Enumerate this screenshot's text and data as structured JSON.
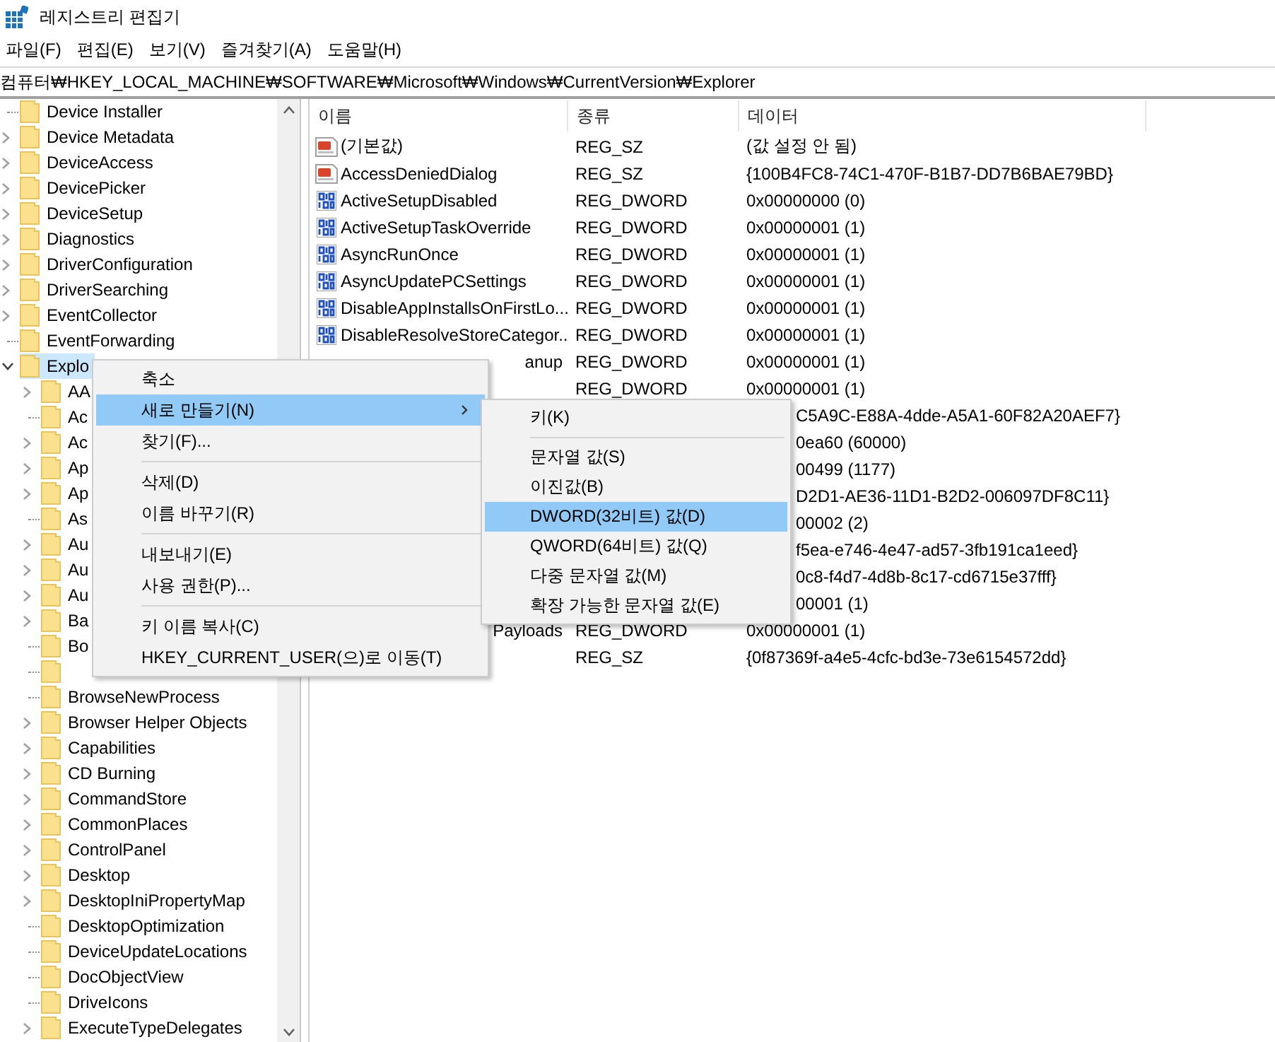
{
  "window": {
    "title": "레지스트리 편집기"
  },
  "menu_bar": [
    "파일(F)",
    "편집(E)",
    "보기(V)",
    "즐겨찾기(A)",
    "도움말(H)"
  ],
  "address_bar": {
    "value": "컴퓨터₩HKEY_LOCAL_MACHINE₩SOFTWARE₩Microsoft₩Windows₩CurrentVersion₩Explorer"
  },
  "tree": {
    "items": [
      {
        "label": "Device Installer",
        "has_children": false,
        "selected": false
      },
      {
        "label": "Device Metadata",
        "has_children": true,
        "expanded": false,
        "selected": false
      },
      {
        "label": "DeviceAccess",
        "has_children": true,
        "expanded": false,
        "selected": false
      },
      {
        "label": "DevicePicker",
        "has_children": true,
        "expanded": false,
        "selected": false
      },
      {
        "label": "DeviceSetup",
        "has_children": true,
        "expanded": false,
        "selected": false
      },
      {
        "label": "Diagnostics",
        "has_children": true,
        "expanded": false,
        "selected": false
      },
      {
        "label": "DriverConfiguration",
        "has_children": true,
        "expanded": false,
        "selected": false
      },
      {
        "label": "DriverSearching",
        "has_children": true,
        "expanded": false,
        "selected": false
      },
      {
        "label": "EventCollector",
        "has_children": true,
        "expanded": false,
        "selected": false
      },
      {
        "label": "EventForwarding",
        "has_children": false,
        "selected": false
      },
      {
        "label": "Explo",
        "has_children": true,
        "expanded": true,
        "selected": true,
        "children": [
          {
            "label": "AA",
            "has_children": true,
            "expanded": false,
            "selected": false
          },
          {
            "label": "Ac",
            "has_children": false,
            "selected": false
          },
          {
            "label": "Ac",
            "has_children": true,
            "expanded": false,
            "selected": false
          },
          {
            "label": "Ap",
            "has_children": true,
            "expanded": false,
            "selected": false
          },
          {
            "label": "Ap",
            "has_children": true,
            "expanded": false,
            "selected": false
          },
          {
            "label": "As",
            "has_children": false,
            "selected": false
          },
          {
            "label": "Au",
            "has_children": true,
            "expanded": false,
            "selected": false
          },
          {
            "label": "Au",
            "has_children": true,
            "expanded": false,
            "selected": false
          },
          {
            "label": "Au",
            "has_children": true,
            "expanded": false,
            "selected": false
          },
          {
            "label": "Ba",
            "has_children": true,
            "expanded": false,
            "selected": false
          },
          {
            "label": "Bo",
            "has_children": false,
            "selected": false
          },
          {
            "has_children": false,
            "selected": false
          },
          {
            "label": "BrowseNewProcess",
            "has_children": false,
            "selected": false
          },
          {
            "label": "Browser Helper Objects",
            "has_children": true,
            "expanded": false,
            "selected": false
          },
          {
            "label": "Capabilities",
            "has_children": true,
            "expanded": false,
            "selected": false
          },
          {
            "label": "CD Burning",
            "has_children": true,
            "expanded": false,
            "selected": false
          },
          {
            "label": "CommandStore",
            "has_children": true,
            "expanded": false,
            "selected": false
          },
          {
            "label": "CommonPlaces",
            "has_children": true,
            "expanded": false,
            "selected": false
          },
          {
            "label": "ControlPanel",
            "has_children": true,
            "expanded": false,
            "selected": false
          },
          {
            "label": "Desktop",
            "has_children": true,
            "expanded": false,
            "selected": false
          },
          {
            "label": "DesktopIniPropertyMap",
            "has_children": true,
            "expanded": false,
            "selected": false
          },
          {
            "label": "DesktopOptimization",
            "has_children": false,
            "selected": false
          },
          {
            "label": "DeviceUpdateLocations",
            "has_children": false,
            "selected": false
          },
          {
            "label": "DocObjectView",
            "has_children": false,
            "selected": false
          },
          {
            "label": "DriveIcons",
            "has_children": false,
            "selected": false
          },
          {
            "label": "ExecuteTypeDelegates",
            "has_children": true,
            "expanded": false,
            "selected": false
          }
        ]
      }
    ]
  },
  "list": {
    "columns": [
      "이름",
      "종류",
      "데이터"
    ],
    "rows": [
      {
        "kind": "string",
        "name": "(기본값)",
        "type": "REG_SZ",
        "data": "(값 설정 안 됨)"
      },
      {
        "kind": "string",
        "name": "AccessDeniedDialog",
        "type": "REG_SZ",
        "data": "{100B4FC8-74C1-470F-B1B7-DD7B6BAE79BD}"
      },
      {
        "kind": "binary",
        "name": "ActiveSetupDisabled",
        "type": "REG_DWORD",
        "data": "0x00000000 (0)"
      },
      {
        "kind": "binary",
        "name": "ActiveSetupTaskOverride",
        "type": "REG_DWORD",
        "data": "0x00000001 (1)"
      },
      {
        "kind": "binary",
        "name": "AsyncRunOnce",
        "type": "REG_DWORD",
        "data": "0x00000001 (1)"
      },
      {
        "kind": "binary",
        "name": "AsyncUpdatePCSettings",
        "type": "REG_DWORD",
        "data": "0x00000001 (1)"
      },
      {
        "kind": "binary",
        "name": "DisableAppInstallsOnFirstLo...",
        "type": "REG_DWORD",
        "data": "0x00000001 (1)"
      },
      {
        "kind": "binary",
        "name": "DisableResolveStoreCategor...",
        "type": "REG_DWORD",
        "data": "0x00000001 (1)"
      },
      {
        "kind": "name_tail",
        "name": "anup",
        "type": "REG_DWORD",
        "data": "0x00000001 (1)"
      },
      {
        "kind": "covered",
        "type": "REG_DWORD",
        "data": "0x00000001 (1)"
      },
      {
        "kind": "data_tail",
        "data": "C5A9C-E88A-4dde-A5A1-60F82A20AEF7}"
      },
      {
        "kind": "data_tail",
        "data": "0ea60 (60000)"
      },
      {
        "kind": "data_tail",
        "data": "00499 (1177)"
      },
      {
        "kind": "data_tail",
        "data": "D2D1-AE36-11D1-B2D2-006097DF8C11}"
      },
      {
        "kind": "data_tail",
        "data": "00002 (2)"
      },
      {
        "kind": "data_tail",
        "data": "f5ea-e746-4e47-ad57-3fb191ca1eed}"
      },
      {
        "kind": "data_tail",
        "data": "0c8-f4d7-4d8b-8c17-cd6715e37fff}"
      },
      {
        "kind": "data_tail",
        "data": "00001 (1)"
      },
      {
        "kind": "name_tail",
        "name": "Payloads",
        "type": "REG_DWORD",
        "data": "0x00000001 (1)"
      },
      {
        "kind": "covered",
        "type": "REG_SZ",
        "data": "{0f87369f-a4e5-4cfc-bd3e-73e6154572dd}"
      }
    ]
  },
  "context_menu": {
    "items": [
      {
        "kind": "item",
        "label": "축소",
        "selected": false
      },
      {
        "kind": "item",
        "label": "새로 만들기(N)",
        "selected": true,
        "submenu": true
      },
      {
        "kind": "item",
        "label": "찾기(F)...",
        "selected": false
      },
      {
        "kind": "separator"
      },
      {
        "kind": "item",
        "label": "삭제(D)",
        "selected": false
      },
      {
        "kind": "item",
        "label": "이름 바꾸기(R)",
        "selected": false
      },
      {
        "kind": "separator"
      },
      {
        "kind": "item",
        "label": "내보내기(E)",
        "selected": false
      },
      {
        "kind": "item",
        "label": "사용 권한(P)...",
        "selected": false
      },
      {
        "kind": "separator"
      },
      {
        "kind": "item",
        "label": "키 이름 복사(C)",
        "selected": false
      },
      {
        "kind": "item",
        "label": "HKEY_CURRENT_USER(으)로 이동(T)",
        "selected": false
      }
    ]
  },
  "submenu": {
    "items": [
      {
        "kind": "item",
        "label": "키(K)",
        "selected": false
      },
      {
        "kind": "separator"
      },
      {
        "kind": "item",
        "label": "문자열 값(S)",
        "selected": false
      },
      {
        "kind": "item",
        "label": "이진값(B)",
        "selected": false
      },
      {
        "kind": "item",
        "label": "DWORD(32비트) 값(D)",
        "selected": true
      },
      {
        "kind": "item",
        "label": "QWORD(64비트) 값(Q)",
        "selected": false
      },
      {
        "kind": "item",
        "label": "다중 문자열 값(M)",
        "selected": false
      },
      {
        "kind": "item",
        "label": "확장 가능한 문자열 값(E)",
        "selected": false
      }
    ]
  }
}
